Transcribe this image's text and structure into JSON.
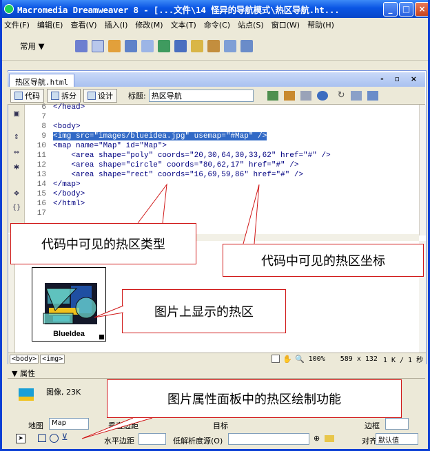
{
  "window": {
    "title": "Macromedia Dreamweaver 8 - [...文件\\14 怪异的导航模式\\热区导航.ht...",
    "controls": {
      "minimize": "_",
      "maximize": "□",
      "close": "×"
    }
  },
  "menu": [
    "文件(F)",
    "编辑(E)",
    "查看(V)",
    "插入(I)",
    "修改(M)",
    "文本(T)",
    "命令(C)",
    "站点(S)",
    "窗口(W)",
    "帮助(H)"
  ],
  "insert_bar": {
    "category": "常用 ▼"
  },
  "document": {
    "tab_name": "热区导航.html",
    "tab_controls": "- ▫ ×",
    "views": {
      "code": "代码",
      "split": "拆分",
      "design": "设计"
    },
    "title_label": "标题:",
    "title_value": "热区导航"
  },
  "code_lines": [
    {
      "n": "6",
      "text": "</head>"
    },
    {
      "n": "7",
      "text": ""
    },
    {
      "n": "8",
      "text": "<body>"
    },
    {
      "n": "9",
      "text": "<img src=\"images/blueidea.jpg\" usemap=\"#Map\" />"
    },
    {
      "n": "10",
      "text": "<map name=\"Map\" id=\"Map\">"
    },
    {
      "n": "11",
      "text": "    <area shape=\"poly\" coords=\"20,30,64,30,33,62\" href=\"#\" />"
    },
    {
      "n": "12",
      "text": "    <area shape=\"circle\" coords=\"80,62,17\" href=\"#\" />"
    },
    {
      "n": "13",
      "text": "    <area shape=\"rect\" coords=\"16,69,59,86\" href=\"#\" />"
    },
    {
      "n": "14",
      "text": "</map>"
    },
    {
      "n": "15",
      "text": "</body>"
    },
    {
      "n": "16",
      "text": "</html>"
    },
    {
      "n": "17",
      "text": ""
    }
  ],
  "image": {
    "caption": "BlueIdea"
  },
  "status_bar": {
    "tag1": "<body>",
    "tag2": "<img>",
    "zoom": "100%",
    "size": "589 x 132",
    "download": "1 K / 1 秒"
  },
  "properties": {
    "header": "▼ 属性",
    "type_label": "图像, 23K",
    "map_label": "地图",
    "map_value": "Map",
    "vspace_label": "垂直边距",
    "target_label": "目标",
    "border_label": "边框",
    "hspace_label": "水平边距",
    "lowsrc_label": "低解析度源(O)",
    "align_label": "对齐",
    "align_value": "默认值"
  },
  "callouts": {
    "hotspot_type": "代码中可见的热区类型",
    "hotspot_coords": "代码中可见的热区坐标",
    "image_hotspots": "图片上显示的热区",
    "panel_tools": "图片属性面板中的热区绘制功能"
  },
  "colors": {
    "titlebar": "#0a55e4",
    "selection": "#3169c6",
    "callout_border": "#d01818"
  }
}
